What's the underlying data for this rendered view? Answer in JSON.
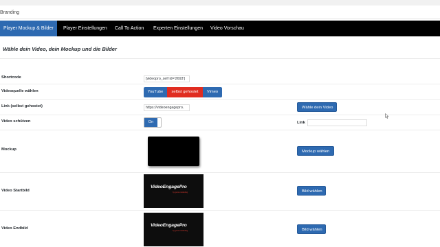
{
  "header": {
    "branding_label": "Branding"
  },
  "tabs": [
    {
      "label": "Player Mockup & Bilder"
    },
    {
      "label": "Player Einstellungen"
    },
    {
      "label": "Call To Action"
    },
    {
      "label": "Experten Einstellungen"
    },
    {
      "label": "Video Vorschau"
    }
  ],
  "section": {
    "title": "Wähle dein Video, dein Mockup und die Bilder"
  },
  "form": {
    "shortcode": {
      "label": "Shortcode",
      "value": "[videopro_self id='2693']"
    },
    "source": {
      "label": "Videoquelle wählen",
      "options": [
        "YouTube",
        "selbst gehostet",
        "Vimeo"
      ],
      "selected": "selbst gehostet",
      "colors": {
        "default": "#2e6ab1",
        "selected": "#e02c20"
      }
    },
    "link_self": {
      "label": "Link (selbst gehostet)",
      "value": "https://videoengagepro.",
      "button_label": "Wähle dein Video"
    },
    "protect": {
      "label": "Video schützen",
      "toggle_label": "On",
      "link_label": "Link",
      "link_value": ""
    },
    "mockup": {
      "label": "Mockup",
      "button_label": "Mockup wählen"
    },
    "start_image": {
      "label": "Video Startbild",
      "thumb_brand": "VideoEngagePro",
      "thumb_tag": "by gurus marketing",
      "button_label": "Bild wählen"
    },
    "end_image": {
      "label": "Video Endbild",
      "thumb_brand": "VideoEngagePro",
      "thumb_tag": "by gurus marketing",
      "button_label": "Bild wählen"
    }
  },
  "colors": {
    "accent": "#2e6ab1",
    "tabbar": "#000000",
    "danger": "#e02c20"
  }
}
